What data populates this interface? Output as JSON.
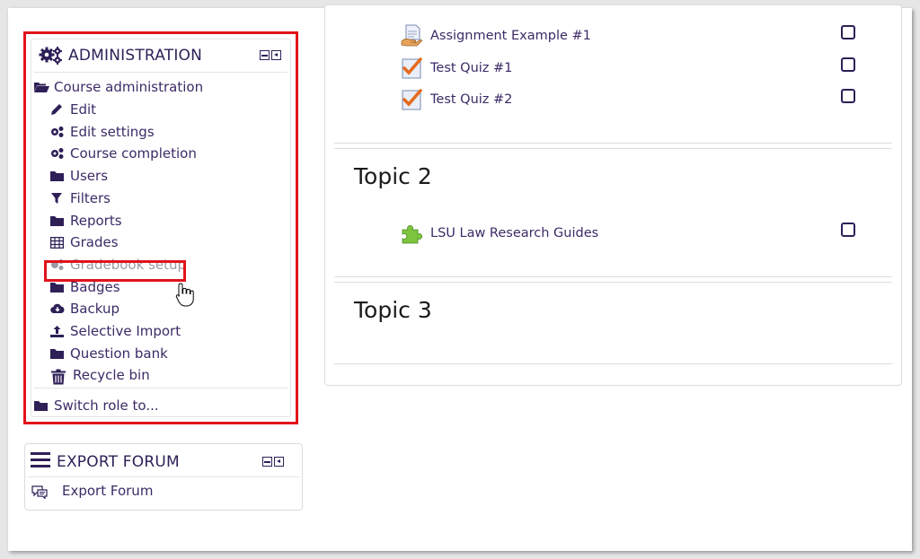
{
  "admin": {
    "title": "ADMINISTRATION",
    "items": [
      {
        "label": "Course administration",
        "icon": "folder-open-icon"
      },
      {
        "label": "Edit",
        "icon": "pencil-icon"
      },
      {
        "label": "Edit settings",
        "icon": "cogs-icon"
      },
      {
        "label": "Course completion",
        "icon": "cogs-icon"
      },
      {
        "label": "Users",
        "icon": "folder-icon"
      },
      {
        "label": "Filters",
        "icon": "filter-icon"
      },
      {
        "label": "Reports",
        "icon": "folder-icon"
      },
      {
        "label": "Grades",
        "icon": "table-icon"
      },
      {
        "label": "Gradebook setup",
        "icon": "cogs-icon"
      },
      {
        "label": "Badges",
        "icon": "folder-icon"
      },
      {
        "label": "Backup",
        "icon": "cloud-download-icon"
      },
      {
        "label": "Selective Import",
        "icon": "upload-icon"
      },
      {
        "label": "Question bank",
        "icon": "folder-icon"
      },
      {
        "label": "Recycle bin",
        "icon": "trash-icon"
      }
    ],
    "switch_role": "Switch role to..."
  },
  "export": {
    "title": "EXPORT FORUM",
    "link": "Export Forum"
  },
  "activities": [
    {
      "label": "Assignment Example #1",
      "icon": "assignment-icon"
    },
    {
      "label": "Test Quiz #1",
      "icon": "quiz-icon"
    },
    {
      "label": "Test Quiz #2",
      "icon": "quiz-icon"
    }
  ],
  "topics": [
    {
      "title": "Topic 2",
      "activity": "LSU Law Research Guides",
      "icon": "puzzle-icon"
    },
    {
      "title": "Topic 3"
    }
  ],
  "colors": {
    "highlight": "#e1131b",
    "link": "#3d2a66"
  }
}
